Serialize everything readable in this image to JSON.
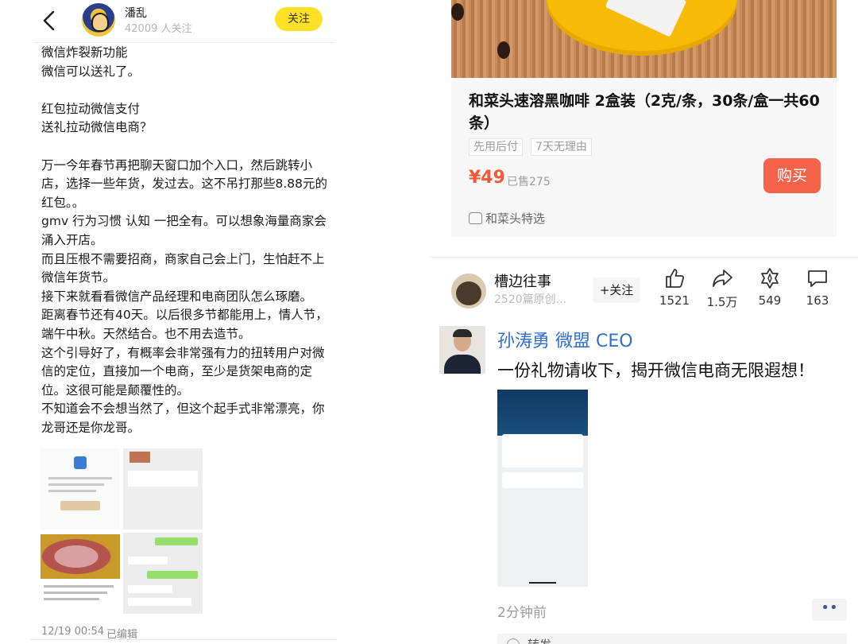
{
  "left": {
    "header": {
      "user_name": "潘乱",
      "followers": "42009 人关注",
      "follow_label": "关注"
    },
    "post": {
      "paragraphs": [
        [
          "微信炸裂新功能",
          "微信可以送礼了。"
        ],
        [
          "红包拉动微信支付",
          "送礼拉动微信电商？"
        ],
        [
          "万一今年春节再把聊天窗口加个入口，然后跳转小店，选择一些年货，发过去。这不吊打那些8.88元的红包。。",
          "gmv 行为习惯 认知 一把全有。可以想象海量商家会涌入开店。",
          "而且压根不需要招商，商家自己会上门，生怕赶不上微信年货节。",
          "接下来就看看微信产品经理和电商团队怎么琢磨。",
          "距离春节还有40天。以后很多节都能用上，情人节，端午中秋。天然结合。也不用去造节。",
          "这个引导好了，有概率会非常强有力的扭转用户对微信的定位，直接加一个电商，至少是货架电商的定位。这很可能是颠覆性的。",
          "不知道会不会想当然了，但这个起手式非常漂亮，你龙哥还是你龙哥。"
        ]
      ]
    },
    "meta": {
      "time": "12/19 00:54",
      "edited": "已编辑"
    }
  },
  "right": {
    "product": {
      "title": "和菜头速溶黑咖啡 2盒装（2克/条，30条/盒一共60条）",
      "tags": [
        "先用后付",
        "7天无理由"
      ],
      "price": "¥49",
      "sold": "已售275",
      "buy_label": "购买",
      "shop_name": "和菜头特选"
    },
    "author": {
      "name": "槽边往事",
      "sub": "2520篇原创...",
      "follow_label": "+关注"
    },
    "actions": [
      {
        "icon": "thumbs-up-icon",
        "count": "1521"
      },
      {
        "icon": "share-icon",
        "count": "1.5万"
      },
      {
        "icon": "star-badge-icon",
        "count": "549"
      },
      {
        "icon": "comment-icon",
        "count": "163"
      }
    ],
    "moment": {
      "name": "孙涛勇 微盟 CEO",
      "text": "一份礼物请收下，揭开微信电商无限遐想！",
      "time_ago": "2分钟前",
      "more_label": "••",
      "cut_text": "转发"
    }
  },
  "colors": {
    "follow_yellow": "#ffe025",
    "price_red": "#f25a3c",
    "buy_button": "#f4634a",
    "link_blue": "#2f6fd0"
  }
}
